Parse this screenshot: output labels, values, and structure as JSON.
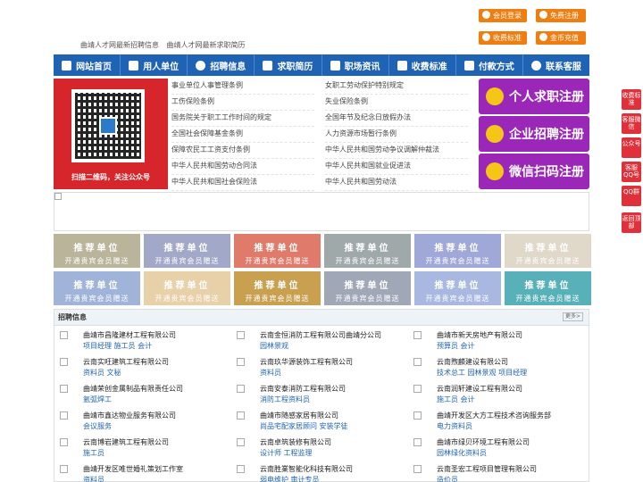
{
  "header": {
    "links": [
      "曲靖人才网最新招聘信息",
      "曲靖人才网最新求职简历"
    ],
    "buttons": [
      "会员登录",
      "免费注册",
      "收费标准",
      "金币充值"
    ]
  },
  "nav": [
    "网站首页",
    "用人单位",
    "招聘信息",
    "求职简历",
    "职场资讯",
    "收费标准",
    "付款方式",
    "联系客服"
  ],
  "qr": {
    "caption": "扫描二维码，关注公众号"
  },
  "laws": {
    "left": [
      "事业单位人事管理条例",
      "工伤保险条例",
      "国务院关于职工工作时间的规定",
      "全国社会保障基金条例",
      "保障农民工工资支付条例",
      "中华人民共和国劳动合同法",
      "中华人民共和国社会保险法"
    ],
    "right": [
      "女职工劳动保护特别规定",
      "失业保险条例",
      "全国年节及纪念日放假办法",
      "人力资源市场暂行条例",
      "中华人民共和国劳动争议调解仲裁法",
      "中华人民共和国就业促进法",
      "中华人民共和国劳动法"
    ]
  },
  "register": [
    "个人求职注册",
    "企业招聘注册",
    "微信扫码注册"
  ],
  "side": [
    "收费标准",
    "客服微信",
    "公众号",
    "客服QQ号",
    "QQ群",
    "返回顶部"
  ],
  "tiles": {
    "title": "推荐单位",
    "sub": "开通贵宾会员赠送",
    "colors": [
      "#b9b49a",
      "#a2a9c8",
      "#e07a6a",
      "#9fa9aa",
      "#a0a8d8",
      "#e0d8c8",
      "#9fb4d8",
      "#e8d0a8",
      "#c8a050",
      "#a0a8b8",
      "#a8b8e0",
      "#58b0b8"
    ]
  },
  "jobs": {
    "title": "招聘信息",
    "more": "更多>",
    "items": [
      {
        "company": "曲靖市昌隆建材工程有限公司",
        "positions": "项目经理 施工员 会计"
      },
      {
        "company": "云南金恒消防工程有限公司曲靖分公司",
        "positions": "园林景观"
      },
      {
        "company": "曲靖市新天房地产有限公司",
        "positions": "预算员 会计"
      },
      {
        "company": "云南实旺建筑工程有限公司",
        "positions": "资料员 文秘"
      },
      {
        "company": "云南玖华源装饰工程有限公司",
        "positions": "资料员"
      },
      {
        "company": "云南煦麟建设有限公司",
        "positions": "技术总工 园林景观 项目经理"
      },
      {
        "company": "曲靖荣创金属制品有限责任公司",
        "positions": "氩弧焊工"
      },
      {
        "company": "云南安泰消防工程有限公司",
        "positions": "消防工程资料员"
      },
      {
        "company": "云南润轩建设工程有限公司",
        "positions": "施工员 会计"
      },
      {
        "company": "曲靖市鑫达物业服务有限公司",
        "positions": "会议服务"
      },
      {
        "company": "曲靖市随感家居有限公司",
        "positions": "尚品宅配家居顾问 安装学徒"
      },
      {
        "company": "曲靖开发区大方工程技术咨询服务部",
        "positions": "电力资料员"
      },
      {
        "company": "云南博岩建筑工程有限公司",
        "positions": "施工员"
      },
      {
        "company": "云南卓筑装修有限公司",
        "positions": "设计师 工程监理"
      },
      {
        "company": "曲靖市绿贝环境工程有限公司",
        "positions": "园林绿化资料员"
      },
      {
        "company": "曲靖开发区唯世婚礼策划工作室",
        "positions": "资料员"
      },
      {
        "company": "云南胜業智能化科技有限公司",
        "positions": "弱电维护 审计专员"
      },
      {
        "company": "云南圣宏工程项目管理有限公司",
        "positions": "造价员"
      }
    ]
  }
}
